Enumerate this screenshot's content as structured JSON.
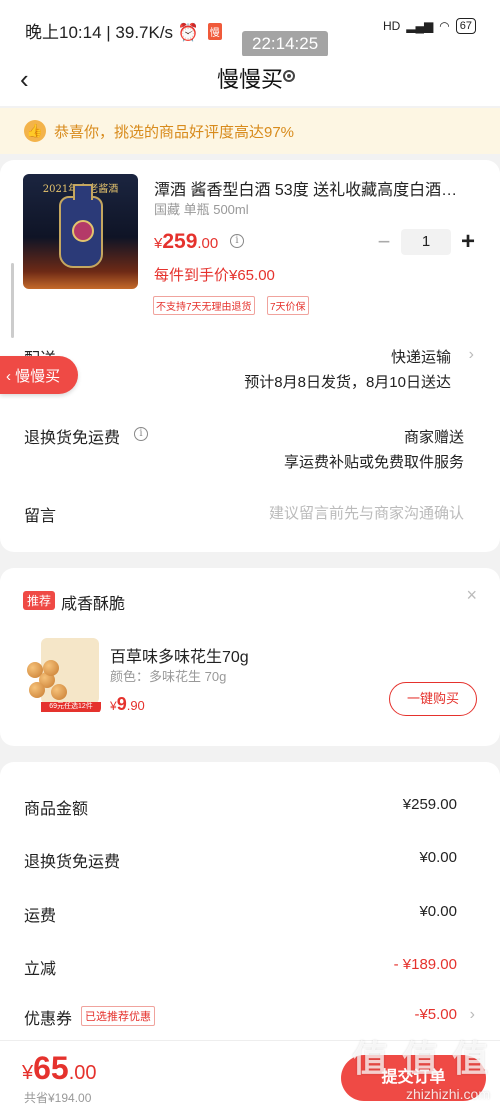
{
  "status_bar": {
    "time_speed": "晚上10:14 | 39.7K/s",
    "alarm_icon": "alarm-icon",
    "app_badge": "慢",
    "signal": "HD",
    "battery": "67",
    "overlay_clock": "22:14:25"
  },
  "header": {
    "back_icon": "‹",
    "title": "慢慢买"
  },
  "banner": {
    "icon": "thumbs-up-icon",
    "text": "恭喜你，挑选的商品好评度高达97%"
  },
  "product": {
    "image_year_text": "2021年产老酱酒",
    "name": "潭酒 酱香型白酒 53度 送礼收藏高度白酒…",
    "spec": "国藏 单瓶 500ml",
    "price_symbol": "¥",
    "price_int": "259",
    "price_dec": ".00",
    "info_icon": "i",
    "qty_minus": "−",
    "quantity": "1",
    "qty_plus": "+",
    "unit_price_text": "每件到手价¥65.00",
    "tags": [
      "不支持7天无理由退货",
      "7天价保"
    ]
  },
  "float_button": "‹ 慢慢买",
  "delivery": {
    "label": "配送",
    "method": "快递运输",
    "estimate": "预计8月8日发货，8月10日送达"
  },
  "return_shipping": {
    "label": "退换货免运费",
    "line1": "商家赠送",
    "line2": "享运费补贴或免费取件服务"
  },
  "message": {
    "label": "留言",
    "placeholder": "建议留言前先与商家沟通确认"
  },
  "recommend": {
    "tag": "推荐",
    "title": "咸香酥脆",
    "close": "×",
    "item_name": "百草味多味花生70g",
    "item_spec": "颜色：多味花生 70g",
    "image_strip": "69元任选12件",
    "price_symbol": "¥",
    "price_int": "9",
    "price_dec": ".90",
    "buy_button": "一键购买"
  },
  "summary": {
    "rows": [
      {
        "label": "商品金额",
        "value": "¥259.00"
      },
      {
        "label": "退换货免运费",
        "value": "¥0.00"
      },
      {
        "label": "运费",
        "value": "¥0.00"
      },
      {
        "label": "立减",
        "value": "- ¥189.00"
      },
      {
        "label": "优惠券",
        "value": "-¥5.00"
      }
    ],
    "coupon_tag": "已选推荐优惠"
  },
  "bottom": {
    "total_symbol": "¥",
    "total_int": "65",
    "total_dec": ".00",
    "saved": "共省¥194.00",
    "submit": "提交订单"
  },
  "watermark": {
    "text": "值 值 值",
    "url": "zhizhizhi.com"
  },
  "colors": {
    "accent": "#e5322d",
    "banner_bg": "#fdf6e3",
    "banner_text": "#d88b1c"
  }
}
